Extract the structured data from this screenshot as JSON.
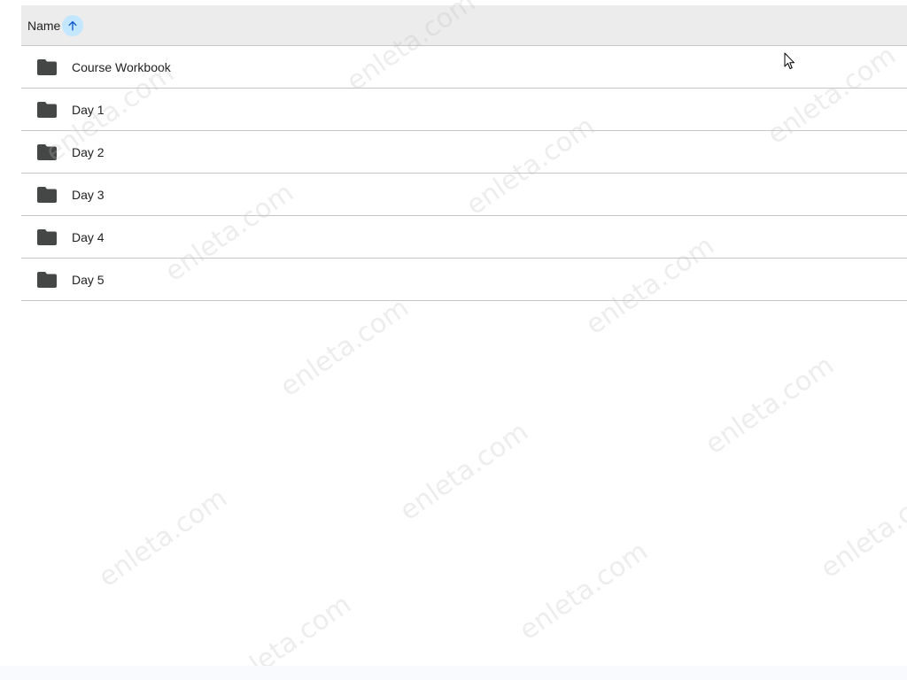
{
  "list": {
    "header": {
      "name_label": "Name",
      "sort_icon": "arrow-upward-icon",
      "sort_color": "#c2e7ff"
    },
    "items": [
      {
        "label": "Course Workbook",
        "icon": "folder-icon"
      },
      {
        "label": "Day 1",
        "icon": "folder-icon"
      },
      {
        "label": "Day 2",
        "icon": "folder-icon"
      },
      {
        "label": "Day 3",
        "icon": "folder-icon"
      },
      {
        "label": "Day 4",
        "icon": "folder-icon"
      },
      {
        "label": "Day 5",
        "icon": "folder-icon"
      }
    ]
  },
  "watermark": {
    "text": "enleta.com"
  },
  "colors": {
    "header_bg": "#ececec",
    "row_divider": "#c7c7c7",
    "folder_icon": "#444746",
    "text": "#1f1f1f"
  }
}
